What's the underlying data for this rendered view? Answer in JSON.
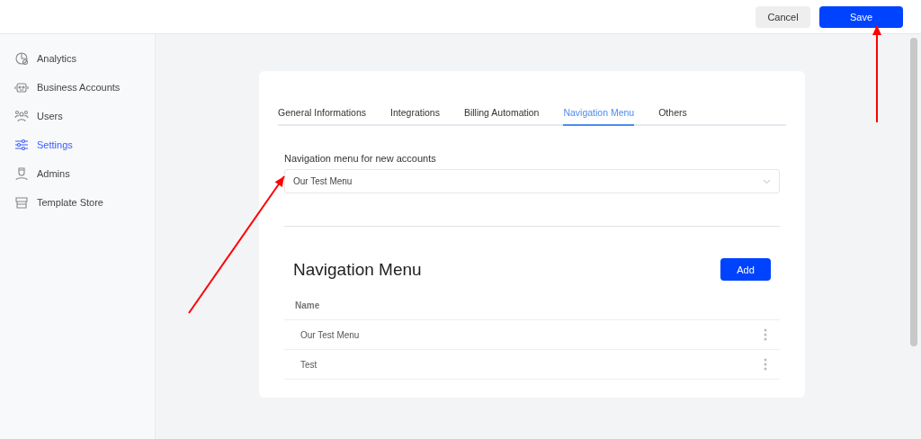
{
  "header": {
    "buttons": [
      {
        "label": "Cancel",
        "kind": "secondary"
      },
      {
        "label": "Save",
        "kind": "primary"
      }
    ]
  },
  "sidebar": {
    "items": [
      {
        "label": "Analytics",
        "kind": "chart",
        "selected": false
      },
      {
        "label": "Business Accounts",
        "kind": "robot",
        "selected": false
      },
      {
        "label": "Users",
        "kind": "users",
        "selected": false
      },
      {
        "label": "Settings",
        "kind": "sliders",
        "selected": true
      },
      {
        "label": "Admins",
        "kind": "admin",
        "selected": false
      },
      {
        "label": "Template Store",
        "kind": "store",
        "selected": false
      }
    ]
  },
  "tabs": [
    {
      "label": "General Informations",
      "selected": false
    },
    {
      "label": "Integrations",
      "selected": false
    },
    {
      "label": "Billing Automation",
      "selected": false
    },
    {
      "label": "Navigation Menu",
      "selected": true
    },
    {
      "label": "Others",
      "selected": false
    }
  ],
  "select": {
    "label": "Navigation menu for new accounts",
    "value": "Our Test Menu"
  },
  "section": {
    "title": "Navigation Menu",
    "button": "Add"
  },
  "table": {
    "columns": [
      "Name"
    ],
    "rows": [
      {
        "name": "Our Test Menu"
      },
      {
        "name": "Test"
      }
    ]
  },
  "annotations": [
    {
      "kind": "arrow"
    },
    {
      "kind": "arrow"
    }
  ]
}
